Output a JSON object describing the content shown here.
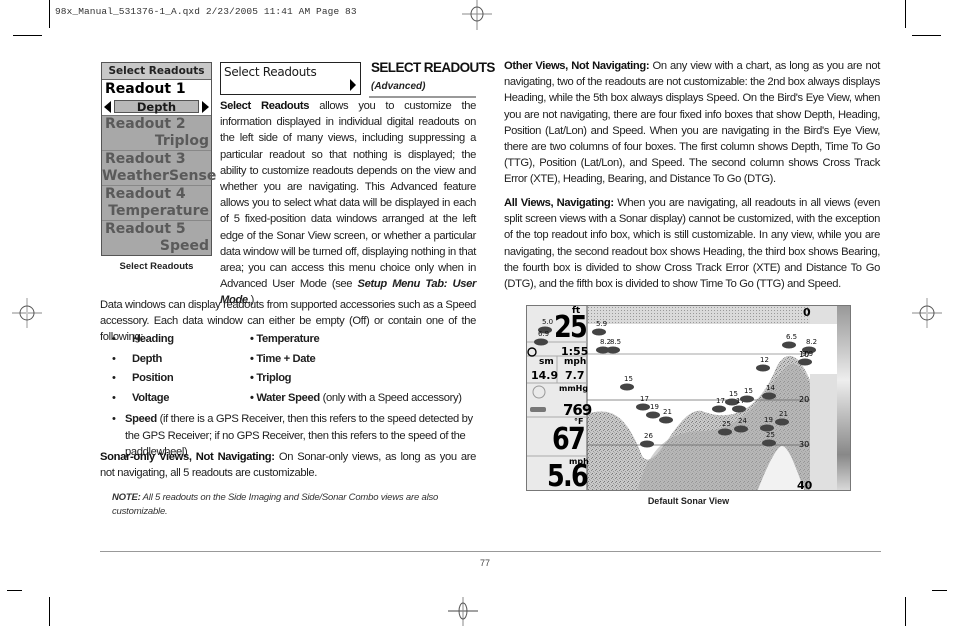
{
  "print_slug": "98x_Manual_531376-1_A.qxd  2/23/2005  11:41 AM  Page 83",
  "device_menu": {
    "title": "Select Readouts",
    "selected": {
      "label": "Readout 1",
      "value": "Depth"
    },
    "items": [
      {
        "label": "Readout 2",
        "value": "Triplog"
      },
      {
        "label": "Readout 3",
        "value": "WeatherSense"
      },
      {
        "label": "Readout 4",
        "value": "Temperature"
      },
      {
        "label": "Readout 5",
        "value": "Speed"
      }
    ],
    "caption": "Select Readouts"
  },
  "menu_tab": {
    "label": "Select Readouts"
  },
  "section": {
    "title": "SELECT READOUTS",
    "subtitle": "(Advanced)"
  },
  "intro": {
    "lead": "Select Readouts",
    "body": " allows you to customize the information displayed in individual digital readouts on the left side of many views, including suppressing a particular readout so that nothing is displayed; the ability to customize readouts depends on the view and whether you are navigating. This Advanced feature allows you to select what data will be displayed in each of 5 fixed-position data windows arranged at the left edge of the Sonar View screen, or whether a particular data window will be turned off, displaying nothing in that area; you can access this menu choice only when in Advanced User Mode (see ",
    "link": "Setup Menu Tab: User Mode",
    "tail": ".)"
  },
  "data_windows": "Data windows can display readouts from supported accessories such as a Speed accessory. Each data window can either be empty (Off) or contain one of the following:",
  "bullets_left": [
    "Heading",
    "Depth",
    "Position",
    "Voltage"
  ],
  "bullets_right": [
    "Temperature",
    "Time + Date",
    "Triplog",
    "Water Speed"
  ],
  "water_speed_note": " (only with a Speed accessory)",
  "speed_bullet": {
    "label": "Speed",
    "text": "  (if there is a GPS Receiver, then this refers to the speed detected by the GPS Receiver; if no GPS Receiver, then this refers to the speed of the paddlewheel)"
  },
  "sonar_only": {
    "lead": "Sonar-only Views, Not Navigating:",
    "body": " On Sonar-only views, as long as you are not navigating, all 5 readouts are customizable."
  },
  "note": {
    "lead": "NOTE:",
    "body": " All 5 readouts on the Side Imaging and Side/Sonar Combo views are also customizable."
  },
  "other_views": {
    "lead": "Other Views, Not Navigating:",
    "body": " On any view with a chart, as long as you are not navigating, two of the readouts are not customizable: the 2nd box always displays Heading, while the 5th box always displays Speed. On the Bird's Eye View, when you are not navigating, there are four fixed info boxes that show Depth, Heading, Position (Lat/Lon) and Speed. When you are navigating in the Bird's Eye View, there are two columns of four boxes. The first column shows Depth, Time To Go (TTG), Position (Lat/Lon), and Speed. The second column shows Cross Track Error (XTE), Heading, Bearing, and Distance To Go (DTG)."
  },
  "all_views": {
    "lead": "All Views, Navigating:",
    "body": " When you are navigating, all readouts in all views (even split screen views with a Sonar display) cannot be customized, with the exception of the top readout info box, which is still customizable. In any view, while you are navigating, the second readout box shows Heading, the third box shows Bearing, the fourth box is divided to show Cross Track Error (XTE) and Distance To Go (DTG), and the fifth box is divided to show Time To Go (TTG) and Speed."
  },
  "sonar_view": {
    "caption": "Default Sonar View",
    "readouts": {
      "depth_unit": "ft",
      "depth": "25",
      "time": "1:55",
      "trip_unit_left": "sm",
      "trip_unit_right": "mph",
      "trip_left": "14.9",
      "trip_right": "7.7",
      "pressure_unit": "mmHg",
      "pressure": "769",
      "temp_unit": "°F",
      "temp": "67",
      "speed_unit": "mph",
      "speed": "5.6"
    },
    "depth_scale": [
      "0",
      "10",
      "20",
      "30",
      "40"
    ],
    "fish_labels": [
      "5.0",
      "6.9",
      "5.9",
      "8.2",
      "8.5",
      "15",
      "17",
      "19",
      "21",
      "26",
      "17",
      "15",
      "17",
      "15",
      "14",
      "25",
      "24",
      "12",
      "19",
      "21",
      "25",
      "6.5",
      "8.2",
      "9.9"
    ]
  },
  "page_number": "77"
}
